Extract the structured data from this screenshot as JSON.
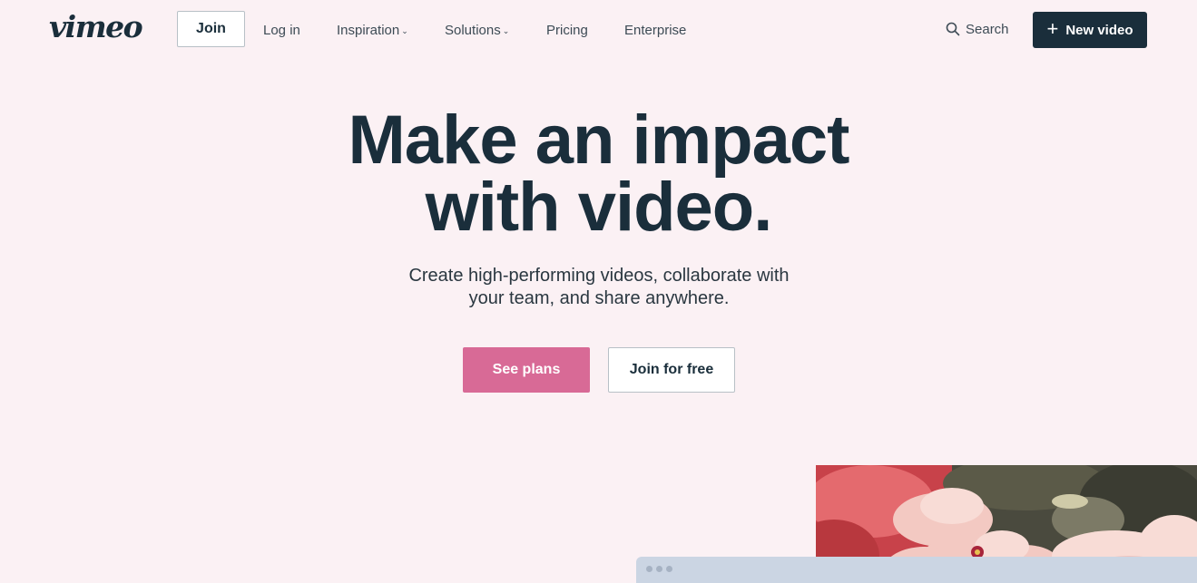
{
  "nav": {
    "logo_text": "vimeo",
    "join_label": "Join",
    "login_label": "Log in",
    "inspiration_label": "Inspiration",
    "solutions_label": "Solutions",
    "pricing_label": "Pricing",
    "enterprise_label": "Enterprise",
    "search_label": "Search",
    "new_video_label": "New video"
  },
  "hero": {
    "title_line1": "Make an impact",
    "title_line2": "with video.",
    "subtitle_line1": "Create high-performing videos, collaborate with",
    "subtitle_line2": "your team, and share anywhere.",
    "see_plans_label": "See plans",
    "join_free_label": "Join for free"
  },
  "colors": {
    "background": "#fbf1f4",
    "primary_text": "#1a2e3b",
    "accent_pink": "#d86a96",
    "dark_button": "#1a2e3b"
  }
}
